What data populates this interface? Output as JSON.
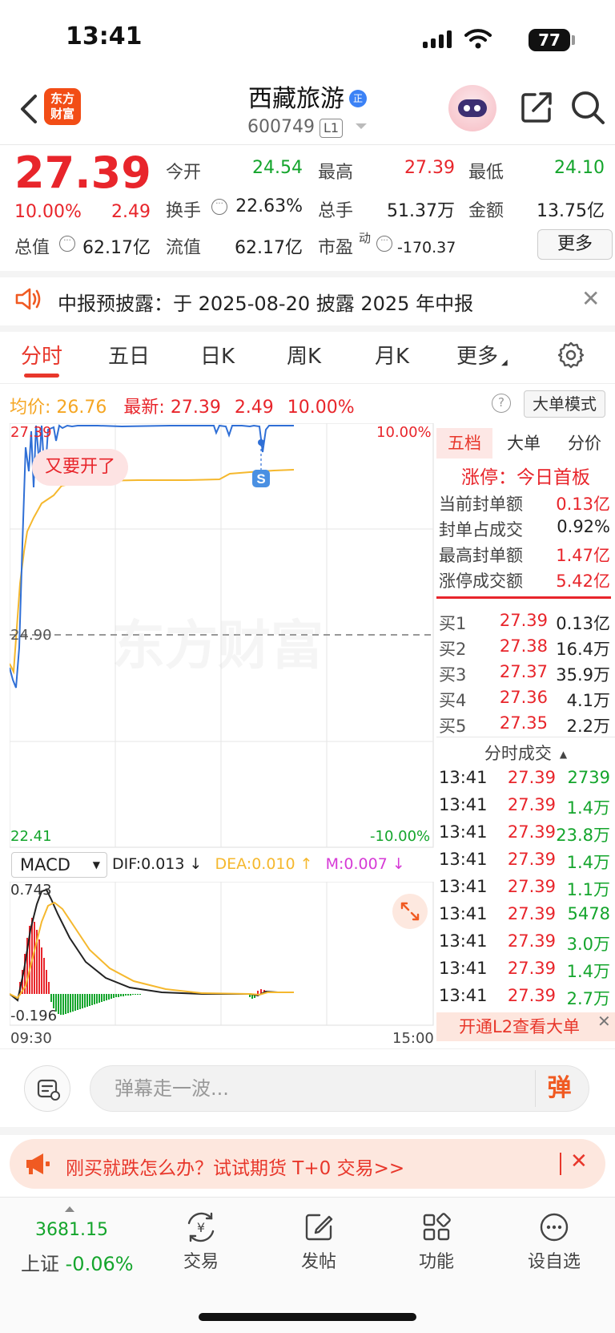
{
  "status_bar": {
    "time": "13:41",
    "battery": "77"
  },
  "header": {
    "app_logo": "东方财富",
    "stock_name": "西藏旅游",
    "badge": "正",
    "stock_code": "600749",
    "level": "L1",
    "icons": [
      "back-icon",
      "robot-avatar",
      "share-icon",
      "search-icon"
    ]
  },
  "quote": {
    "price": "27.39",
    "change_pct": "10.00%",
    "change": "2.49",
    "fields": [
      {
        "label": "今开",
        "value": "24.54",
        "color": "#14a52c"
      },
      {
        "label": "最高",
        "value": "27.39",
        "color": "#e8252b"
      },
      {
        "label": "最低",
        "value": "24.10",
        "color": "#14a52c"
      },
      {
        "label": "换手",
        "value": "22.63%",
        "color": "#222222"
      },
      {
        "label": "总手",
        "value": "51.37万",
        "color": "#222222"
      },
      {
        "label": "金额",
        "value": "13.75亿",
        "color": "#222222"
      },
      {
        "label": "总值",
        "value": "62.17亿",
        "color": "#222222"
      },
      {
        "label": "流值",
        "value": "62.17亿",
        "color": "#222222"
      },
      {
        "label": "市盈",
        "value": "-170.37",
        "color": "#222222"
      }
    ],
    "pe_superscript": "动",
    "more_label": "更多"
  },
  "notice": {
    "text": "中报预披露：于 2025-08-20 披露 2025 年中报"
  },
  "tabs": {
    "items": [
      "分时",
      "五日",
      "日K",
      "周K",
      "月K",
      "更多"
    ],
    "active": "分时"
  },
  "intraday": {
    "avg_label": "均价:",
    "avg_value": "26.76",
    "latest_label": "最新:",
    "latest_value": "27.39",
    "latest_change": "2.49",
    "latest_pct": "10.00%",
    "mode_button": "大单模式",
    "y_top": "27.39",
    "y_mid": "24.90",
    "y_bottom": "22.41",
    "pct_top": "10.00%",
    "pct_bottom": "-10.00%",
    "annotation": "又要开了",
    "s_marker": "S",
    "watermark": "东方财富",
    "time_start": "09:30",
    "time_end": "15:00",
    "colors": {
      "price_line": "#2f6fd6",
      "avg_line": "#f5b82e"
    }
  },
  "macd": {
    "indicator": "MACD",
    "dif": "DIF:0.013 ↓",
    "dea": "DEA:0.010 ↑",
    "m": "M:0.007 ↓",
    "y_top": "0.743",
    "y_bottom": "-0.196"
  },
  "side_panel": {
    "tabs": [
      "五档",
      "大单",
      "分价"
    ],
    "limit_title": "涨停：今日首板",
    "limit_stats": [
      {
        "label": "当前封单额",
        "value": "0.13亿"
      },
      {
        "label": "封单占成交",
        "value": "0.92%"
      },
      {
        "label": "最高封单额",
        "value": "1.47亿"
      },
      {
        "label": "涨停成交额",
        "value": "5.42亿"
      }
    ],
    "bids": [
      {
        "label": "买1",
        "price": "27.39",
        "vol": "0.13亿"
      },
      {
        "label": "买2",
        "price": "27.38",
        "vol": "16.4万"
      },
      {
        "label": "买3",
        "price": "27.37",
        "vol": "35.9万"
      },
      {
        "label": "买4",
        "price": "27.36",
        "vol": "4.1万"
      },
      {
        "label": "买5",
        "price": "27.35",
        "vol": "2.2万"
      }
    ],
    "ticks_title": "分时成交",
    "ticks": [
      {
        "time": "13:41",
        "price": "27.39",
        "vol": "2739"
      },
      {
        "time": "13:41",
        "price": "27.39",
        "vol": "1.4万"
      },
      {
        "time": "13:41",
        "price": "27.39",
        "vol": "23.8万"
      },
      {
        "time": "13:41",
        "price": "27.39",
        "vol": "1.4万"
      },
      {
        "time": "13:41",
        "price": "27.39",
        "vol": "1.1万"
      },
      {
        "time": "13:41",
        "price": "27.39",
        "vol": "5478"
      },
      {
        "time": "13:41",
        "price": "27.39",
        "vol": "3.0万"
      },
      {
        "time": "13:41",
        "price": "27.39",
        "vol": "1.4万"
      },
      {
        "time": "13:41",
        "price": "27.39",
        "vol": "2.7万"
      }
    ],
    "l2_banner": "开通L2查看大单"
  },
  "danmaku": {
    "placeholder": "弹幕走一波...",
    "send": "弹"
  },
  "promo": {
    "text": "刚买就跌怎么办？试试期货 T+0 交易>>"
  },
  "bottom_nav": {
    "index_value": "3681.15",
    "index_name": "上证",
    "index_pct": "-0.06%",
    "items": [
      "交易",
      "发帖",
      "功能",
      "设自选"
    ]
  }
}
